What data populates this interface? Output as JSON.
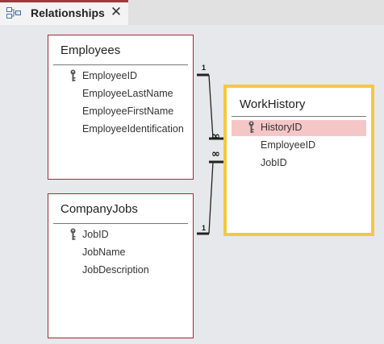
{
  "tab": {
    "label": "Relationships",
    "icon": "relationships-icon",
    "close_glyph": "✕",
    "accent_color": "#a4373a"
  },
  "tables": {
    "employees": {
      "title": "Employees",
      "fields": [
        "EmployeeID",
        "EmployeeLastName",
        "EmployeeFirstName",
        "EmployeeIdentification"
      ],
      "primary_key": "EmployeeID"
    },
    "companyjobs": {
      "title": "CompanyJobs",
      "fields": [
        "JobID",
        "JobName",
        "JobDescription"
      ],
      "primary_key": "JobID"
    },
    "workhistory": {
      "title": "WorkHistory",
      "fields": [
        "HistoryID",
        "EmployeeID",
        "JobID"
      ],
      "primary_key": "HistoryID",
      "selected_field": "HistoryID"
    }
  },
  "relationships": [
    {
      "from_table": "Employees",
      "to_table": "WorkHistory",
      "one_label": "1",
      "many_label": "∞"
    },
    {
      "from_table": "CompanyJobs",
      "to_table": "WorkHistory",
      "one_label": "1",
      "many_label": "∞"
    }
  ],
  "colors": {
    "table_border": "#9e2b35",
    "selection_border": "#f5c842",
    "selected_row": "#f5c6c8",
    "canvas": "#e6e8eb"
  }
}
